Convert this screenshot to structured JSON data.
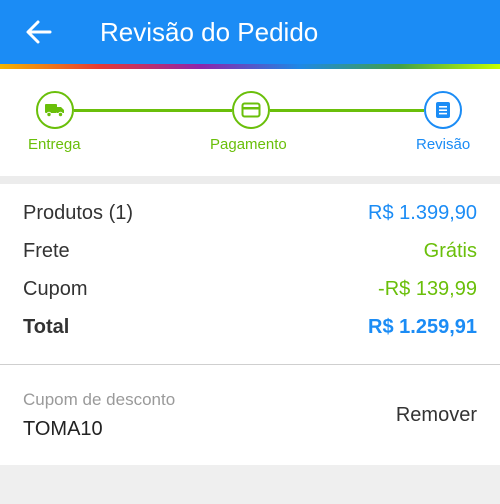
{
  "header": {
    "title": "Revisão do Pedido",
    "back_icon": "arrow-left-icon"
  },
  "stepper": {
    "steps": [
      {
        "label": "Entrega",
        "icon": "truck-icon",
        "state": "done"
      },
      {
        "label": "Pagamento",
        "icon": "credit-card-icon",
        "state": "done"
      },
      {
        "label": "Revisão",
        "icon": "document-icon",
        "state": "active"
      }
    ]
  },
  "summary": {
    "products_label": "Produtos (1)",
    "products_value": "R$ 1.399,90",
    "shipping_label": "Frete",
    "shipping_value": "Grátis",
    "coupon_label": "Cupom",
    "coupon_value": "-R$ 139,99",
    "total_label": "Total",
    "total_value": "R$ 1.259,91"
  },
  "coupon": {
    "field_label": "Cupom de desconto",
    "code": "TOMA10",
    "remove_label": "Remover"
  },
  "colors": {
    "primary": "#1b8cf5",
    "success": "#6abf0a"
  }
}
